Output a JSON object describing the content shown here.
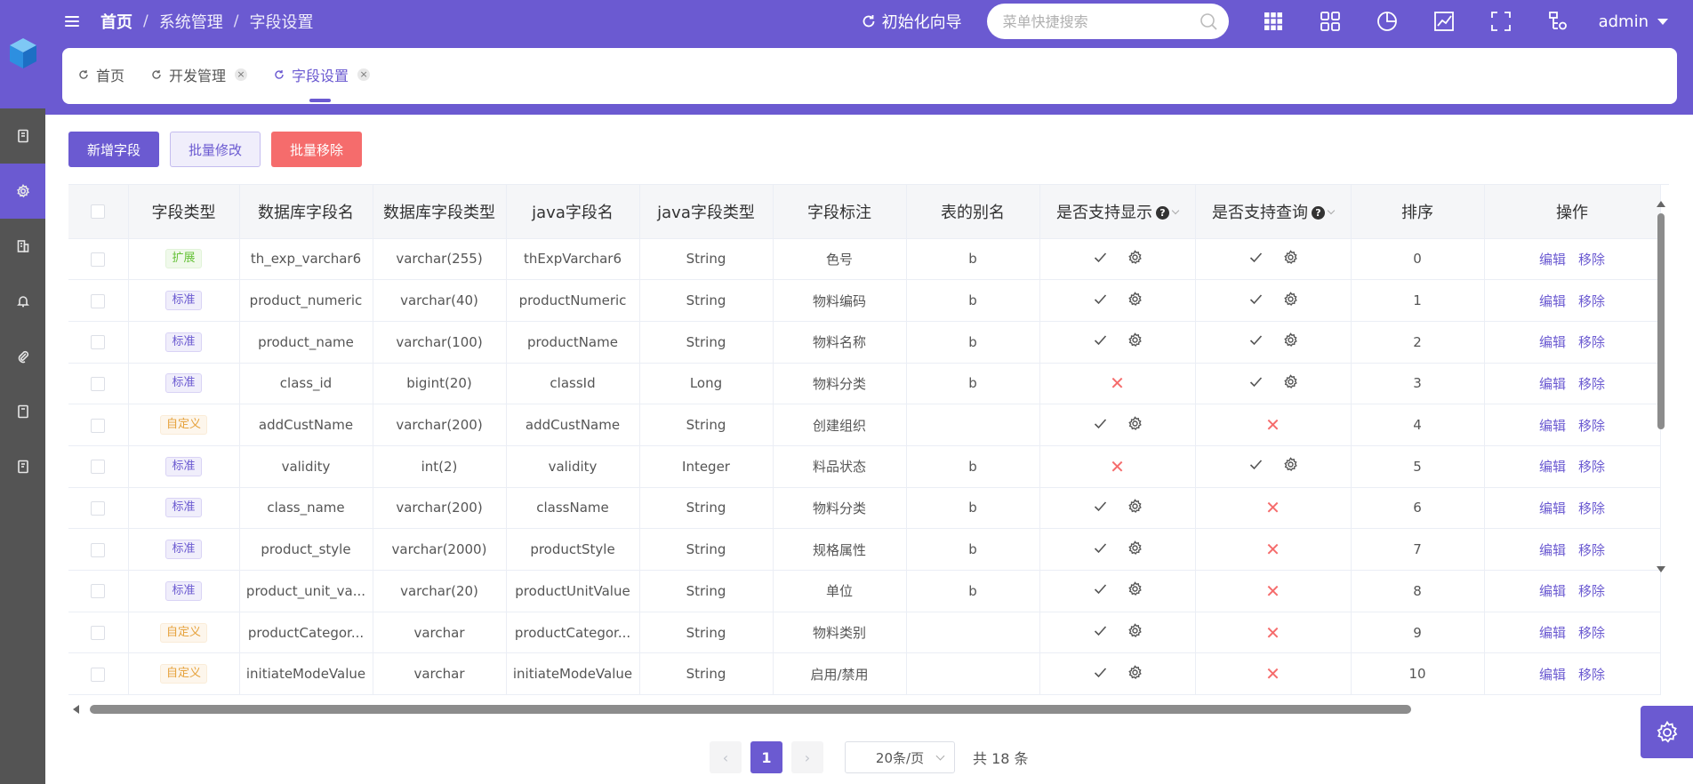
{
  "header": {
    "breadcrumbs": [
      "首页",
      "系统管理",
      "字段设置"
    ],
    "init_wizard": "初始化向导",
    "search_placeholder": "菜单快捷搜索",
    "user": "admin"
  },
  "tabs": [
    {
      "label": "首页",
      "closable": false,
      "active": false
    },
    {
      "label": "开发管理",
      "closable": true,
      "active": false
    },
    {
      "label": "字段设置",
      "closable": true,
      "active": true
    }
  ],
  "toolbar": {
    "add_label": "新增字段",
    "batch_edit_label": "批量修改",
    "batch_remove_label": "批量移除"
  },
  "table": {
    "columns": [
      "字段类型",
      "数据库字段名",
      "数据库字段类型",
      "java字段名",
      "java字段类型",
      "字段标注",
      "表的别名",
      "是否支持显示",
      "是否支持查询",
      "排序",
      "操作"
    ],
    "edit_label": "编辑",
    "remove_label": "移除",
    "rows": [
      {
        "tag": "扩展",
        "tag_type": "ext",
        "db_name": "th_exp_varchar6",
        "db_type": "varchar(255)",
        "java_name": "thExpVarchar6",
        "java_type": "String",
        "label": "色号",
        "alias": "b",
        "display": true,
        "query": true,
        "sort": "0"
      },
      {
        "tag": "标准",
        "tag_type": "std",
        "db_name": "product_numeric",
        "db_type": "varchar(40)",
        "java_name": "productNumeric",
        "java_type": "String",
        "label": "物料编码",
        "alias": "b",
        "display": true,
        "query": true,
        "sort": "1"
      },
      {
        "tag": "标准",
        "tag_type": "std",
        "db_name": "product_name",
        "db_type": "varchar(100)",
        "java_name": "productName",
        "java_type": "String",
        "label": "物料名称",
        "alias": "b",
        "display": true,
        "query": true,
        "sort": "2"
      },
      {
        "tag": "标准",
        "tag_type": "std",
        "db_name": "class_id",
        "db_type": "bigint(20)",
        "java_name": "classId",
        "java_type": "Long",
        "label": "物料分类",
        "alias": "b",
        "display": false,
        "query": true,
        "sort": "3"
      },
      {
        "tag": "自定义",
        "tag_type": "cus",
        "db_name": "addCustName",
        "db_type": "varchar(200)",
        "java_name": "addCustName",
        "java_type": "String",
        "label": "创建组织",
        "alias": "",
        "display": true,
        "query": false,
        "sort": "4"
      },
      {
        "tag": "标准",
        "tag_type": "std",
        "db_name": "validity",
        "db_type": "int(2)",
        "java_name": "validity",
        "java_type": "Integer",
        "label": "料品状态",
        "alias": "b",
        "display": false,
        "query": true,
        "sort": "5"
      },
      {
        "tag": "标准",
        "tag_type": "std",
        "db_name": "class_name",
        "db_type": "varchar(200)",
        "java_name": "className",
        "java_type": "String",
        "label": "物料分类",
        "alias": "b",
        "display": true,
        "query": false,
        "sort": "6"
      },
      {
        "tag": "标准",
        "tag_type": "std",
        "db_name": "product_style",
        "db_type": "varchar(2000)",
        "java_name": "productStyle",
        "java_type": "String",
        "label": "规格属性",
        "alias": "b",
        "display": true,
        "query": false,
        "sort": "7"
      },
      {
        "tag": "标准",
        "tag_type": "std",
        "db_name": "product_unit_va...",
        "db_type": "varchar(20)",
        "java_name": "productUnitValue",
        "java_type": "String",
        "label": "单位",
        "alias": "b",
        "display": true,
        "query": false,
        "sort": "8"
      },
      {
        "tag": "自定义",
        "tag_type": "cus",
        "db_name": "productCategor...",
        "db_type": "varchar",
        "java_name": "productCategor...",
        "java_type": "String",
        "label": "物料类别",
        "alias": "",
        "display": true,
        "query": false,
        "sort": "9"
      },
      {
        "tag": "自定义",
        "tag_type": "cus",
        "db_name": "initiateModeValue",
        "db_type": "varchar",
        "java_name": "initiateModeValue",
        "java_type": "String",
        "label": "启用/禁用",
        "alias": "",
        "display": true,
        "query": false,
        "sort": "10"
      }
    ]
  },
  "pagination": {
    "current_page": "1",
    "page_size": "20条/页",
    "total": "共 18 条"
  },
  "colors": {
    "primary": "#6b5ad1",
    "danger": "#f56c6c",
    "sidebar": "#545454"
  }
}
